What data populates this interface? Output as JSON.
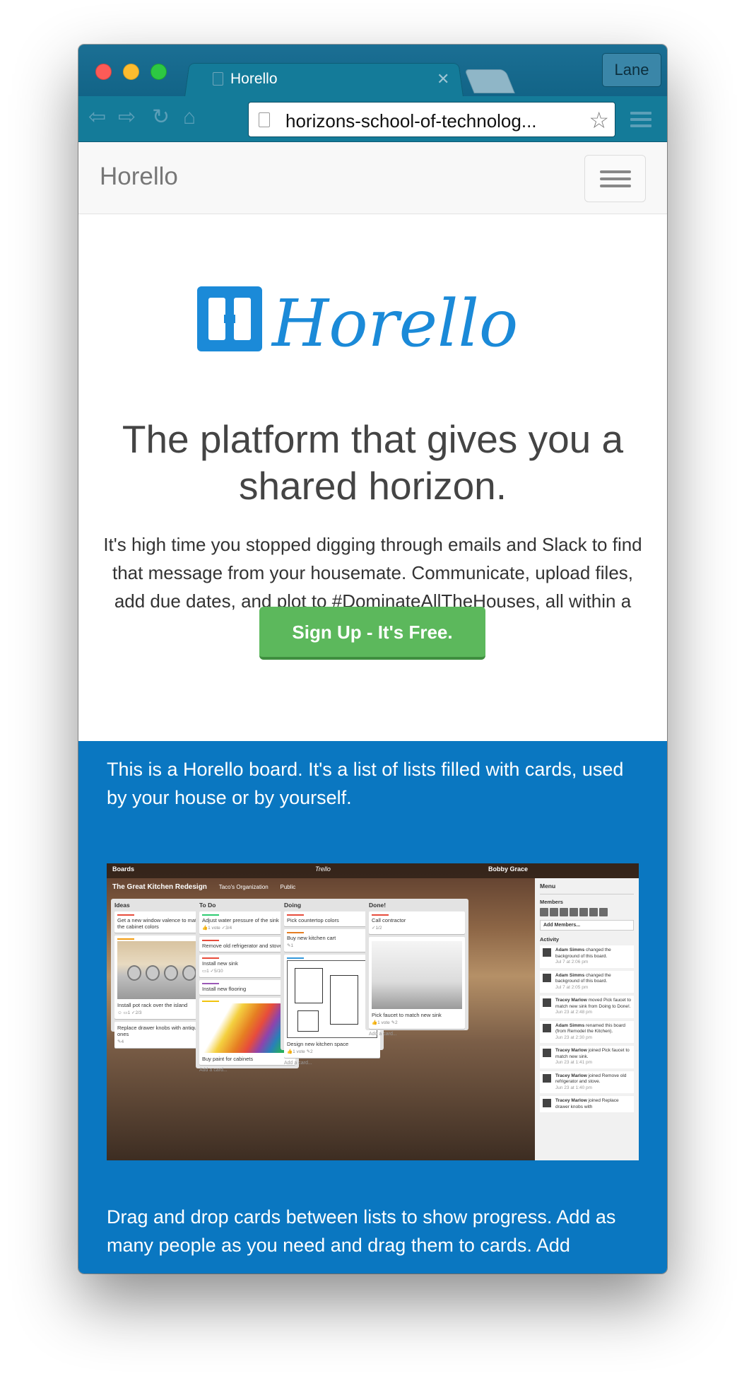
{
  "browser": {
    "tab_title": "Horello",
    "profile_name": "Lane",
    "url": "horizons-school-of-technolog..."
  },
  "navbar": {
    "brand": "Horello"
  },
  "hero": {
    "logo_text": "Horello",
    "headline": "The platform that gives you a shared horizon.",
    "lead": "It's high time you stopped digging through emails and Slack to find that message from your housemate. Communicate, upload files, add due dates, and plot to #DominateAllTheHouses, all within a Horello board.",
    "cta": "Sign Up - It's Free."
  },
  "section": {
    "intro": "This is a Horello board. It's a list of lists filled with cards, used by your house or by yourself.",
    "drag": "Drag and drop cards between lists to show progress. Add as many people as you need and drag them to cards. Add"
  },
  "board": {
    "top_left": "Boards",
    "top_center": "Trello",
    "user": "Bobby Grace",
    "title": "The Great Kitchen Redesign",
    "org": "Taco's Organization",
    "visibility": "Public",
    "lists": [
      {
        "title": "Ideas",
        "cards": [
          "Get a new window valence to match the cabinet colors",
          "Install pot rack over the island",
          "Replace drawer knobs with antique ones"
        ]
      },
      {
        "title": "To Do",
        "cards": [
          "Adjust water pressure of the sink",
          "Remove old refrigerator and stove",
          "Install new sink",
          "Install new flooring",
          "Buy paint for cabinets"
        ]
      },
      {
        "title": "Doing",
        "cards": [
          "Pick countertop colors",
          "Buy new kitchen cart",
          "Design new kitchen space"
        ]
      },
      {
        "title": "Done!",
        "cards": [
          "Call contractor",
          "Pick faucet to match new sink"
        ]
      }
    ],
    "add_card": "Add a card...",
    "menu": {
      "title": "Menu",
      "members": "Members",
      "add_members": "Add Members...",
      "activity": "Activity",
      "items": [
        {
          "who": "Adam Simms",
          "what": "changed the background of this board.",
          "when": "Jul 7 at 2:06 pm"
        },
        {
          "who": "Adam Simms",
          "what": "changed the background of this board.",
          "when": "Jul 7 at 2:05 pm"
        },
        {
          "who": "Tracey Marlow",
          "what": "moved Pick faucet to match new sink from Doing to Done!.",
          "when": "Jun 23 at 2:48 pm"
        },
        {
          "who": "Adam Simms",
          "what": "renamed this board (from Remodel the Kitchen).",
          "when": "Jun 23 at 2:30 pm"
        },
        {
          "who": "Tracey Marlow",
          "what": "joined Pick faucet to match new sink.",
          "when": "Jun 23 at 1:41 pm"
        },
        {
          "who": "Tracey Marlow",
          "what": "joined Remove old refrigerator and stove.",
          "when": "Jun 23 at 1:40 pm"
        },
        {
          "who": "Tracey Marlow",
          "what": "joined Replace drawer knobs with",
          "when": ""
        }
      ]
    }
  },
  "colors": {
    "primary_blue": "#0a77c1",
    "cta_green": "#5cb85c",
    "chrome_teal": "#147b99"
  }
}
